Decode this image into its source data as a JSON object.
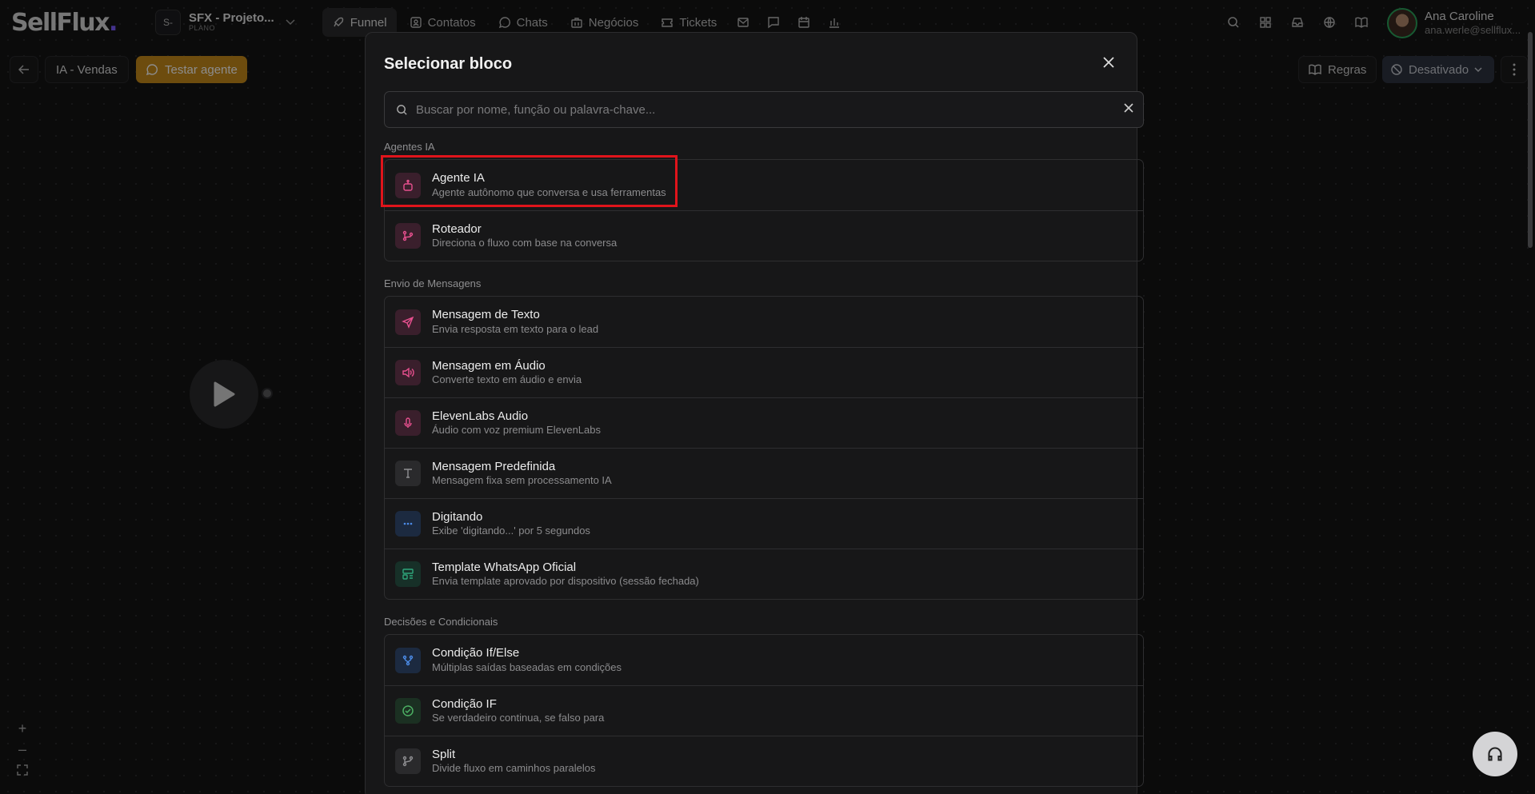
{
  "brand": {
    "logo_text": "SellFlux",
    "logo_dot": "."
  },
  "project": {
    "avatar": "S-",
    "name": "SFX - Projeto...",
    "plan": "PLANO"
  },
  "nav": {
    "tabs": [
      {
        "label": "Funnel",
        "icon": "rocket-icon",
        "active": true
      },
      {
        "label": "Contatos",
        "icon": "contacts-icon"
      },
      {
        "label": "Chats",
        "icon": "chat-icon"
      },
      {
        "label": "Negócios",
        "icon": "briefcase-icon"
      },
      {
        "label": "Tickets",
        "icon": "ticket-icon"
      }
    ]
  },
  "user": {
    "name": "Ana Caroline",
    "email": "ana.werle@sellflux..."
  },
  "toolbar": {
    "flow_name": "IA - Vendas",
    "test_label": "Testar agente",
    "rules_label": "Regras",
    "status_label": "Desativado"
  },
  "modal": {
    "title": "Selecionar bloco",
    "search_placeholder": "Buscar por nome, função ou palavra-chave...",
    "sections": [
      {
        "label": "Agentes IA",
        "items": [
          {
            "title": "Agente IA",
            "desc": "Agente autônomo que conversa e usa ferramentas",
            "icon": "robot-icon"
          },
          {
            "title": "Roteador",
            "desc": "Direciona o fluxo com base na conversa",
            "icon": "route-icon"
          }
        ]
      },
      {
        "label": "Envio de Mensagens",
        "items": [
          {
            "title": "Mensagem de Texto",
            "desc": "Envia resposta em texto para o lead",
            "icon": "send-icon"
          },
          {
            "title": "Mensagem em Áudio",
            "desc": "Converte texto em áudio e envia",
            "icon": "speaker-icon"
          },
          {
            "title": "ElevenLabs Audio",
            "desc": "Áudio com voz premium ElevenLabs",
            "icon": "microphone-icon"
          },
          {
            "title": "Mensagem Predefinida",
            "desc": "Mensagem fixa sem processamento IA",
            "icon": "text-icon"
          },
          {
            "title": "Digitando",
            "desc": "Exibe 'digitando...' por 5 segundos",
            "icon": "dots-icon"
          },
          {
            "title": "Template WhatsApp Oficial",
            "desc": "Envia template aprovado por dispositivo (sessão fechada)",
            "icon": "template-icon"
          }
        ]
      },
      {
        "label": "Decisões e Condicionais",
        "items": [
          {
            "title": "Condição If/Else",
            "desc": "Múltiplas saídas baseadas em condições",
            "icon": "branch-icon"
          },
          {
            "title": "Condição IF",
            "desc": "Se verdadeiro continua, se falso para",
            "icon": "check-circle-icon"
          },
          {
            "title": "Split",
            "desc": "Divide fluxo em caminhos paralelos",
            "icon": "split-icon"
          }
        ]
      }
    ]
  }
}
